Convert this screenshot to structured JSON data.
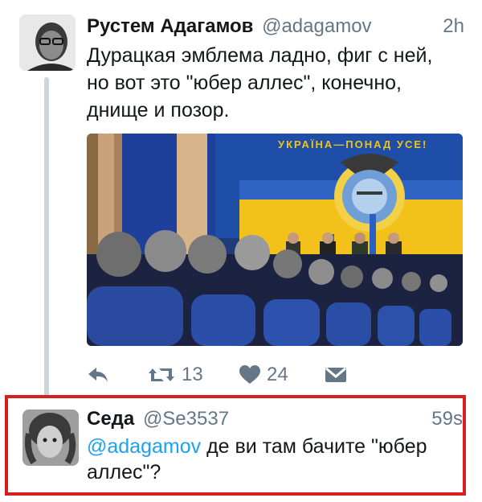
{
  "tweet1": {
    "author_name": "Рустем Адагамов",
    "author_handle": "@adagamov",
    "time": "2h",
    "text_lines": [
      "Дурацкая эмблема ладно, фиг с ней,",
      "но вот это \"юбер аллес\", конечно,",
      "днище и позор."
    ],
    "media": {
      "banner_text": "УКРАЇНА—ПОНАД УСЕ!"
    },
    "actions": {
      "reply_icon": "reply-icon",
      "retweet_icon": "retweet-icon",
      "retweet_count": "13",
      "like_icon": "heart-icon",
      "like_count": "24",
      "dm_icon": "direct-message-icon"
    }
  },
  "tweet2": {
    "author_name": "Седа",
    "author_handle": "@Se3537",
    "time": "59s",
    "mention": "@adagamov",
    "text_line1_rest": " де ви там бачите \"юбер",
    "text_line2": "аллес\"?"
  },
  "colors": {
    "link_blue": "#1da1f2",
    "muted_gray": "#657786",
    "highlight_red": "#d61f1f",
    "thread_line": "#ccd6dd"
  }
}
